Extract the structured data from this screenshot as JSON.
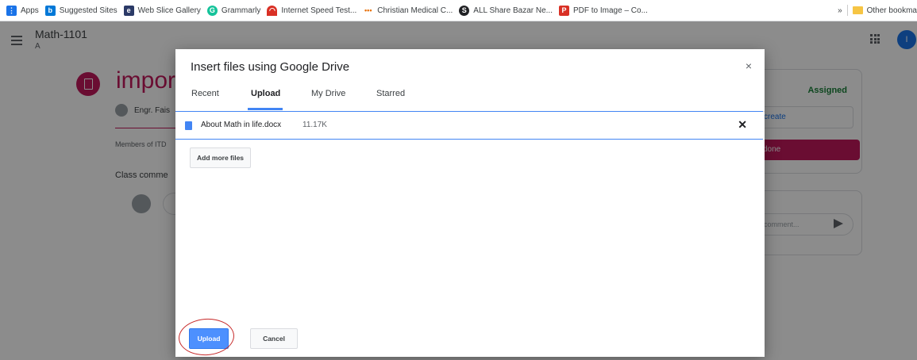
{
  "bookmarks": {
    "items": [
      {
        "label": "Apps",
        "icon": "apps-grid-icon",
        "color": "#1a73e8"
      },
      {
        "label": "Suggested Sites",
        "icon": "bing-icon",
        "color": "#0078d7"
      },
      {
        "label": "Web Slice Gallery",
        "icon": "web-slice-icon",
        "color": "#2b3a67"
      },
      {
        "label": "Grammarly",
        "icon": "grammarly-icon",
        "color": "#15c39a"
      },
      {
        "label": "Internet Speed Test...",
        "icon": "speed-icon",
        "color": "#d93025"
      },
      {
        "label": "Christian Medical C...",
        "icon": "dots-icon",
        "color": "#e8710a"
      },
      {
        "label": "ALL Share Bazar Ne...",
        "icon": "share-icon",
        "color": "#1e8e3e"
      },
      {
        "label": "PDF to Image – Co...",
        "icon": "pdf-icon",
        "color": "#d93025"
      }
    ],
    "overflow": "»",
    "other": "Other bookma"
  },
  "classroom": {
    "class_name": "Math-1101",
    "section": "A",
    "avatar_letter": "I",
    "assignment_title": "impor",
    "author": "Engr. Fais",
    "members": "Members of ITD",
    "class_comments": "Class comme",
    "status": "Assigned",
    "create_label": "create",
    "done_label": "done",
    "comment_placeholder": "comment..."
  },
  "dialog": {
    "title": "Insert files using Google Drive",
    "close": "×",
    "tabs": [
      "Recent",
      "Upload",
      "My Drive",
      "Starred"
    ],
    "active_tab": "Upload",
    "file": {
      "name": "About Math in life.docx",
      "size": "11.17K",
      "remove": "✕"
    },
    "add_more": "Add more files",
    "upload_button": "Upload",
    "cancel_button": "Cancel"
  },
  "colors": {
    "accent": "#4285f4",
    "brand": "#c2185b",
    "annotation": "#c62828"
  }
}
